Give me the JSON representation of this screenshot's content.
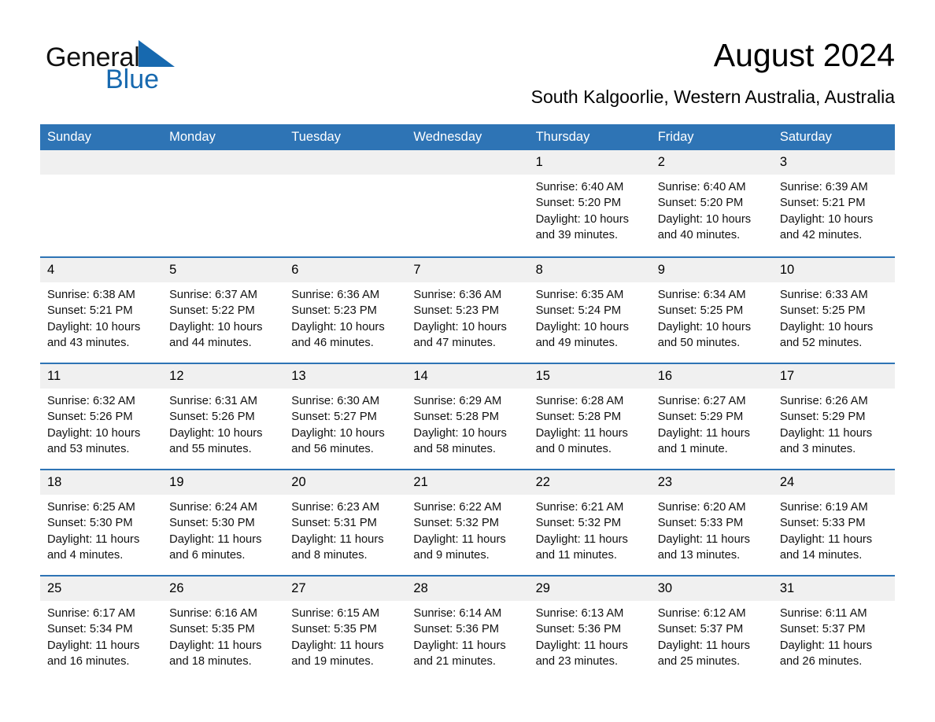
{
  "brand": {
    "name_part1": "General",
    "name_part2": "Blue",
    "accent_color": "#1769AF"
  },
  "header": {
    "title": "August 2024",
    "subtitle": "South Kalgoorlie, Western Australia, Australia",
    "header_bg_color": "#2E74B5",
    "daynum_bg_color": "#F0F0F0"
  },
  "calendar": {
    "weekday_headers": [
      "Sunday",
      "Monday",
      "Tuesday",
      "Wednesday",
      "Thursday",
      "Friday",
      "Saturday"
    ],
    "weeks": [
      [
        {
          "day": "",
          "sunrise": "",
          "sunset": "",
          "daylight": ""
        },
        {
          "day": "",
          "sunrise": "",
          "sunset": "",
          "daylight": ""
        },
        {
          "day": "",
          "sunrise": "",
          "sunset": "",
          "daylight": ""
        },
        {
          "day": "",
          "sunrise": "",
          "sunset": "",
          "daylight": ""
        },
        {
          "day": "1",
          "sunrise": "Sunrise: 6:40 AM",
          "sunset": "Sunset: 5:20 PM",
          "daylight": "Daylight: 10 hours and 39 minutes."
        },
        {
          "day": "2",
          "sunrise": "Sunrise: 6:40 AM",
          "sunset": "Sunset: 5:20 PM",
          "daylight": "Daylight: 10 hours and 40 minutes."
        },
        {
          "day": "3",
          "sunrise": "Sunrise: 6:39 AM",
          "sunset": "Sunset: 5:21 PM",
          "daylight": "Daylight: 10 hours and 42 minutes."
        }
      ],
      [
        {
          "day": "4",
          "sunrise": "Sunrise: 6:38 AM",
          "sunset": "Sunset: 5:21 PM",
          "daylight": "Daylight: 10 hours and 43 minutes."
        },
        {
          "day": "5",
          "sunrise": "Sunrise: 6:37 AM",
          "sunset": "Sunset: 5:22 PM",
          "daylight": "Daylight: 10 hours and 44 minutes."
        },
        {
          "day": "6",
          "sunrise": "Sunrise: 6:36 AM",
          "sunset": "Sunset: 5:23 PM",
          "daylight": "Daylight: 10 hours and 46 minutes."
        },
        {
          "day": "7",
          "sunrise": "Sunrise: 6:36 AM",
          "sunset": "Sunset: 5:23 PM",
          "daylight": "Daylight: 10 hours and 47 minutes."
        },
        {
          "day": "8",
          "sunrise": "Sunrise: 6:35 AM",
          "sunset": "Sunset: 5:24 PM",
          "daylight": "Daylight: 10 hours and 49 minutes."
        },
        {
          "day": "9",
          "sunrise": "Sunrise: 6:34 AM",
          "sunset": "Sunset: 5:25 PM",
          "daylight": "Daylight: 10 hours and 50 minutes."
        },
        {
          "day": "10",
          "sunrise": "Sunrise: 6:33 AM",
          "sunset": "Sunset: 5:25 PM",
          "daylight": "Daylight: 10 hours and 52 minutes."
        }
      ],
      [
        {
          "day": "11",
          "sunrise": "Sunrise: 6:32 AM",
          "sunset": "Sunset: 5:26 PM",
          "daylight": "Daylight: 10 hours and 53 minutes."
        },
        {
          "day": "12",
          "sunrise": "Sunrise: 6:31 AM",
          "sunset": "Sunset: 5:26 PM",
          "daylight": "Daylight: 10 hours and 55 minutes."
        },
        {
          "day": "13",
          "sunrise": "Sunrise: 6:30 AM",
          "sunset": "Sunset: 5:27 PM",
          "daylight": "Daylight: 10 hours and 56 minutes."
        },
        {
          "day": "14",
          "sunrise": "Sunrise: 6:29 AM",
          "sunset": "Sunset: 5:28 PM",
          "daylight": "Daylight: 10 hours and 58 minutes."
        },
        {
          "day": "15",
          "sunrise": "Sunrise: 6:28 AM",
          "sunset": "Sunset: 5:28 PM",
          "daylight": "Daylight: 11 hours and 0 minutes."
        },
        {
          "day": "16",
          "sunrise": "Sunrise: 6:27 AM",
          "sunset": "Sunset: 5:29 PM",
          "daylight": "Daylight: 11 hours and 1 minute."
        },
        {
          "day": "17",
          "sunrise": "Sunrise: 6:26 AM",
          "sunset": "Sunset: 5:29 PM",
          "daylight": "Daylight: 11 hours and 3 minutes."
        }
      ],
      [
        {
          "day": "18",
          "sunrise": "Sunrise: 6:25 AM",
          "sunset": "Sunset: 5:30 PM",
          "daylight": "Daylight: 11 hours and 4 minutes."
        },
        {
          "day": "19",
          "sunrise": "Sunrise: 6:24 AM",
          "sunset": "Sunset: 5:30 PM",
          "daylight": "Daylight: 11 hours and 6 minutes."
        },
        {
          "day": "20",
          "sunrise": "Sunrise: 6:23 AM",
          "sunset": "Sunset: 5:31 PM",
          "daylight": "Daylight: 11 hours and 8 minutes."
        },
        {
          "day": "21",
          "sunrise": "Sunrise: 6:22 AM",
          "sunset": "Sunset: 5:32 PM",
          "daylight": "Daylight: 11 hours and 9 minutes."
        },
        {
          "day": "22",
          "sunrise": "Sunrise: 6:21 AM",
          "sunset": "Sunset: 5:32 PM",
          "daylight": "Daylight: 11 hours and 11 minutes."
        },
        {
          "day": "23",
          "sunrise": "Sunrise: 6:20 AM",
          "sunset": "Sunset: 5:33 PM",
          "daylight": "Daylight: 11 hours and 13 minutes."
        },
        {
          "day": "24",
          "sunrise": "Sunrise: 6:19 AM",
          "sunset": "Sunset: 5:33 PM",
          "daylight": "Daylight: 11 hours and 14 minutes."
        }
      ],
      [
        {
          "day": "25",
          "sunrise": "Sunrise: 6:17 AM",
          "sunset": "Sunset: 5:34 PM",
          "daylight": "Daylight: 11 hours and 16 minutes."
        },
        {
          "day": "26",
          "sunrise": "Sunrise: 6:16 AM",
          "sunset": "Sunset: 5:35 PM",
          "daylight": "Daylight: 11 hours and 18 minutes."
        },
        {
          "day": "27",
          "sunrise": "Sunrise: 6:15 AM",
          "sunset": "Sunset: 5:35 PM",
          "daylight": "Daylight: 11 hours and 19 minutes."
        },
        {
          "day": "28",
          "sunrise": "Sunrise: 6:14 AM",
          "sunset": "Sunset: 5:36 PM",
          "daylight": "Daylight: 11 hours and 21 minutes."
        },
        {
          "day": "29",
          "sunrise": "Sunrise: 6:13 AM",
          "sunset": "Sunset: 5:36 PM",
          "daylight": "Daylight: 11 hours and 23 minutes."
        },
        {
          "day": "30",
          "sunrise": "Sunrise: 6:12 AM",
          "sunset": "Sunset: 5:37 PM",
          "daylight": "Daylight: 11 hours and 25 minutes."
        },
        {
          "day": "31",
          "sunrise": "Sunrise: 6:11 AM",
          "sunset": "Sunset: 5:37 PM",
          "daylight": "Daylight: 11 hours and 26 minutes."
        }
      ]
    ]
  }
}
